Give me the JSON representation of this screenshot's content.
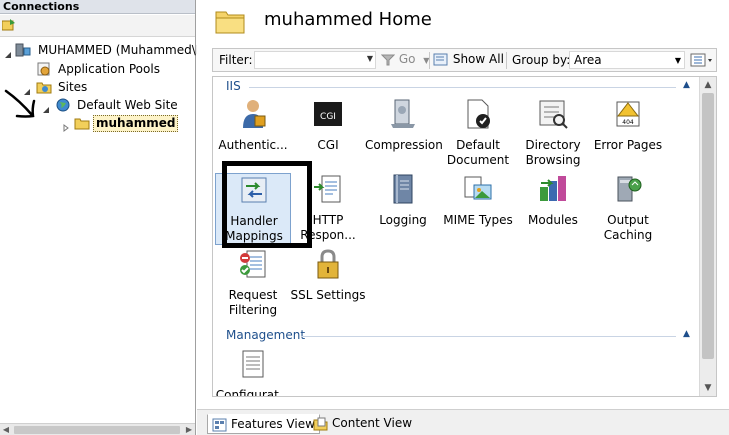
{
  "connections": {
    "header": "Connections",
    "tree": [
      {
        "label": "MUHAMMED (Muhammed\\M",
        "icon": "server-icon"
      },
      {
        "label": "Application Pools",
        "icon": "app-pools-icon"
      },
      {
        "label": "Sites",
        "icon": "sites-folder-icon"
      },
      {
        "label": "Default Web Site",
        "icon": "globe-icon"
      },
      {
        "label": "muhammed",
        "icon": "folder-icon"
      }
    ]
  },
  "main": {
    "title": "muhammed Home",
    "filterbar": {
      "filter_label": "Filter:",
      "filter_value": "",
      "go_label": "Go",
      "show_all_label": "Show All",
      "group_by_label": "Group by:",
      "group_by_value": "Area"
    },
    "groups": [
      {
        "name": "IIS",
        "features": [
          {
            "label": "Authentic...",
            "icon": "authentication-icon"
          },
          {
            "label": "CGI",
            "icon": "cgi-icon"
          },
          {
            "label": "Compression",
            "icon": "compression-icon"
          },
          {
            "label": "Default\nDocument",
            "icon": "default-document-icon"
          },
          {
            "label": "Directory\nBrowsing",
            "icon": "directory-browsing-icon"
          },
          {
            "label": "Error Pages",
            "icon": "error-pages-icon"
          },
          {
            "label": "Handler\nMappings",
            "icon": "handler-mappings-icon"
          },
          {
            "label": "HTTP\nRespon...",
            "icon": "http-response-icon"
          },
          {
            "label": "Logging",
            "icon": "logging-icon"
          },
          {
            "label": "MIME Types",
            "icon": "mime-types-icon"
          },
          {
            "label": "Modules",
            "icon": "modules-icon"
          },
          {
            "label": "Output\nCaching",
            "icon": "output-caching-icon"
          },
          {
            "label": "Request\nFiltering",
            "icon": "request-filtering-icon"
          },
          {
            "label": "SSL Settings",
            "icon": "ssl-settings-icon"
          }
        ]
      },
      {
        "name": "Management",
        "features": [
          {
            "label": "Configurat...",
            "icon": "configuration-editor-icon"
          }
        ]
      }
    ],
    "tabs": [
      {
        "label": "Features View",
        "active": true
      },
      {
        "label": "Content View",
        "active": false
      }
    ]
  },
  "colors": {
    "group_header": "#1e4f8c",
    "selection_fill": "#dbe9f8",
    "selection_border": "#7da2ce"
  }
}
